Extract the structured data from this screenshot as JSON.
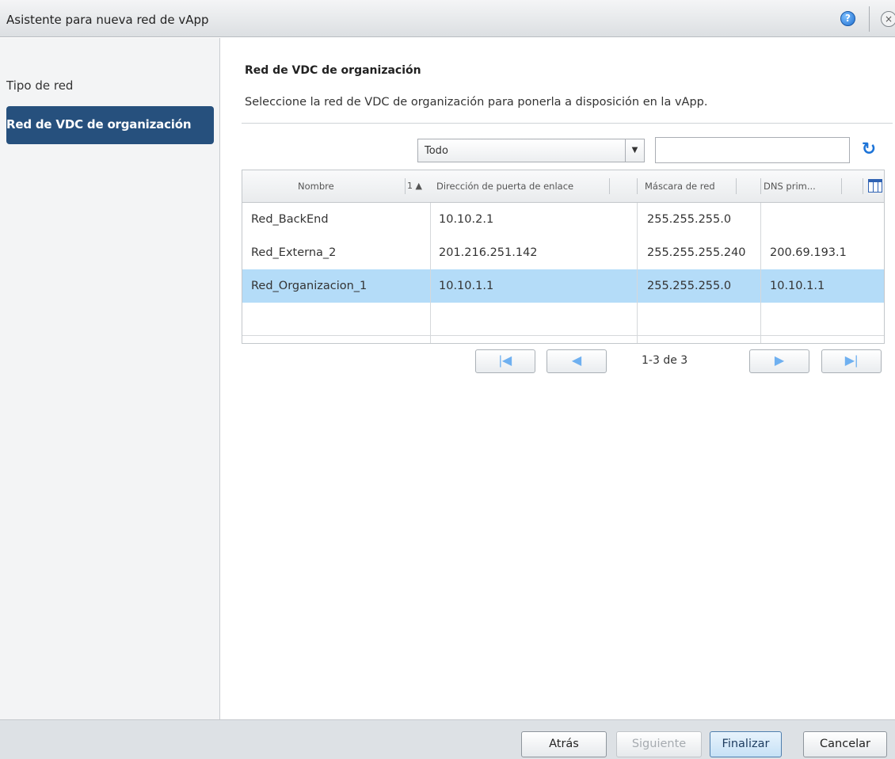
{
  "window": {
    "title": "Asistente para nueva red de vApp",
    "help_icon": "?",
    "close_icon": "×"
  },
  "sidebar": {
    "steps": [
      {
        "label": "Tipo de red",
        "active": false
      },
      {
        "label": "Red de VDC de organización",
        "active": true
      }
    ]
  },
  "main": {
    "title": "Red de VDC de organización",
    "description": "Seleccione la red de VDC de organización para ponerla a disposición en la vApp."
  },
  "filter": {
    "selected": "Todo",
    "arrow": "▼",
    "search_value": "",
    "refresh_icon": "↻"
  },
  "grid": {
    "columns": [
      {
        "label": "Nombre",
        "sort": "1 ▲"
      },
      {
        "label": "Dirección de puerta de enlace"
      },
      {
        "label": "Máscara de red"
      },
      {
        "label": "DNS prim..."
      }
    ],
    "rows": [
      {
        "name": "Red_BackEnd",
        "gateway": "10.10.2.1",
        "mask": "255.255.255.0",
        "dns": "",
        "selected": false
      },
      {
        "name": "Red_Externa_2",
        "gateway": "201.216.251.142",
        "mask": "255.255.255.240",
        "dns": "200.69.193.1",
        "selected": false
      },
      {
        "name": "Red_Organizacion_1",
        "gateway": "10.10.1.1",
        "mask": "255.255.255.0",
        "dns": "10.10.1.1",
        "selected": true
      }
    ]
  },
  "pager": {
    "first": "|◀",
    "prev": "◀",
    "info": "1-3 de 3",
    "next": "▶",
    "last": "▶|"
  },
  "footer": {
    "back": "Atrás",
    "next": "Siguiente",
    "finish": "Finalizar",
    "cancel": "Cancelar"
  },
  "colors": {
    "active_step_bg": "#26507d",
    "selected_row_bg": "#b4dcf8",
    "accent_blue": "#1d74d8"
  }
}
